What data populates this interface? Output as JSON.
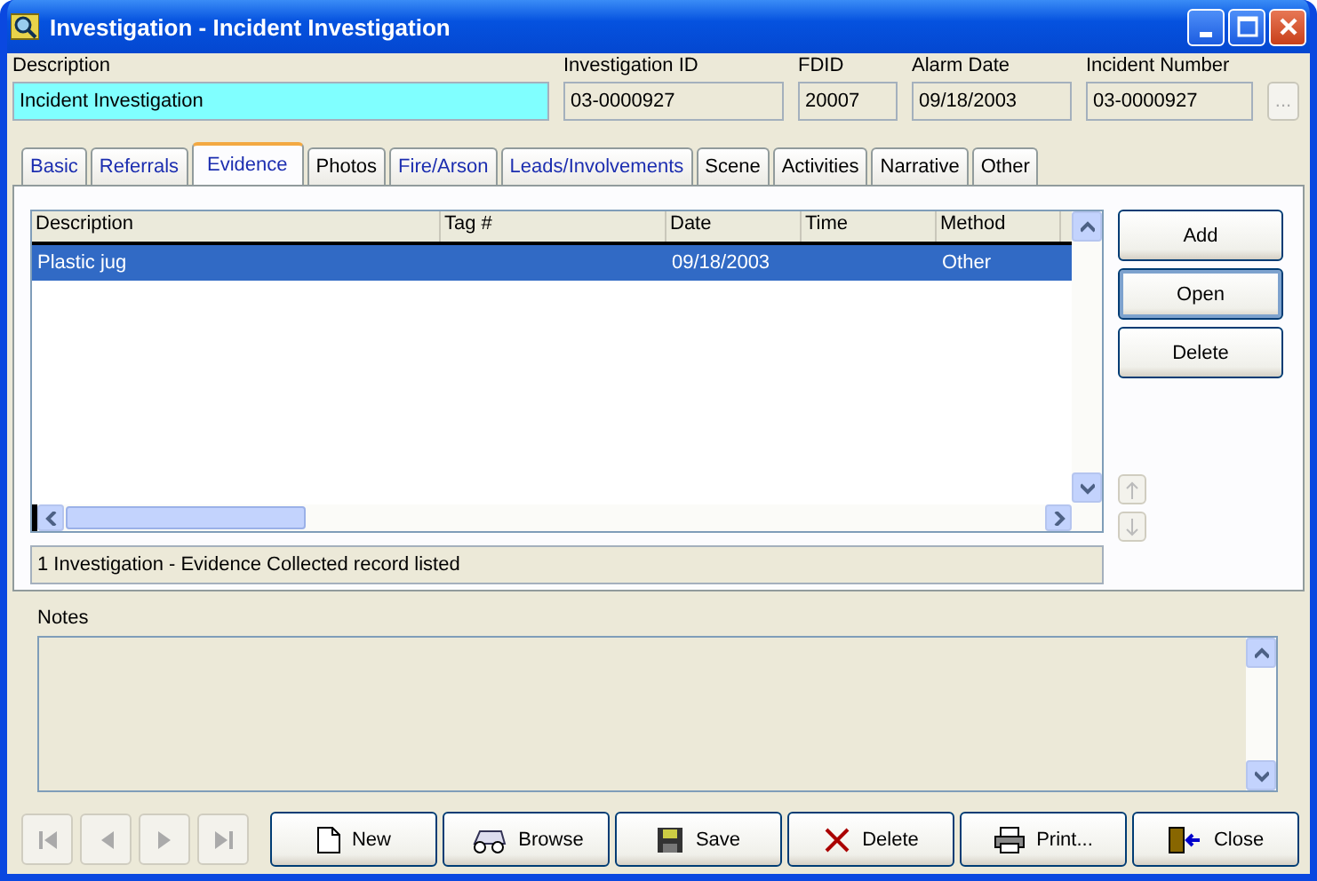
{
  "window": {
    "title": "Investigation - Incident Investigation"
  },
  "header_fields": [
    {
      "label": "Description",
      "value": "Incident Investigation",
      "highlighted": true
    },
    {
      "label": "Investigation ID",
      "value": "03-0000927",
      "highlighted": false
    },
    {
      "label": "FDID",
      "value": "20007",
      "highlighted": false
    },
    {
      "label": "Alarm Date",
      "value": "09/18/2003",
      "highlighted": false
    },
    {
      "label": "Incident Number",
      "value": "03-0000927",
      "highlighted": false
    }
  ],
  "lookup_button": {
    "label": "...",
    "disabled": true
  },
  "tabs": [
    {
      "label": "Basic",
      "selected": false,
      "has_data": true
    },
    {
      "label": "Referrals",
      "selected": false,
      "has_data": true
    },
    {
      "label": "Evidence",
      "selected": true,
      "has_data": true
    },
    {
      "label": "Photos",
      "selected": false,
      "has_data": false
    },
    {
      "label": "Fire/Arson",
      "selected": false,
      "has_data": true
    },
    {
      "label": "Leads/Involvements",
      "selected": false,
      "has_data": true
    },
    {
      "label": "Scene",
      "selected": false,
      "has_data": false
    },
    {
      "label": "Activities",
      "selected": false,
      "has_data": false
    },
    {
      "label": "Narrative",
      "selected": false,
      "has_data": false
    },
    {
      "label": "Other",
      "selected": false,
      "has_data": false
    }
  ],
  "table": {
    "columns": [
      "Description",
      "Tag #",
      "Date",
      "Time",
      "Method"
    ],
    "rows": [
      {
        "cells": [
          "Plastic jug",
          "",
          "09/18/2003",
          "",
          "Other"
        ],
        "selected": true
      }
    ]
  },
  "side_buttons": [
    {
      "label": "Add",
      "focused": false
    },
    {
      "label": "Open",
      "focused": true
    },
    {
      "label": "Delete",
      "focused": false
    }
  ],
  "status": "1 Investigation - Evidence Collected record listed",
  "notes": {
    "label": "Notes"
  },
  "toolbar": [
    {
      "label": "New",
      "kind": "new"
    },
    {
      "label": "Browse",
      "kind": "browse"
    },
    {
      "label": "Save",
      "kind": "save"
    },
    {
      "label": "Delete",
      "kind": "delete"
    },
    {
      "label": "Print...",
      "kind": "print"
    },
    {
      "label": "Close",
      "kind": "close"
    }
  ]
}
